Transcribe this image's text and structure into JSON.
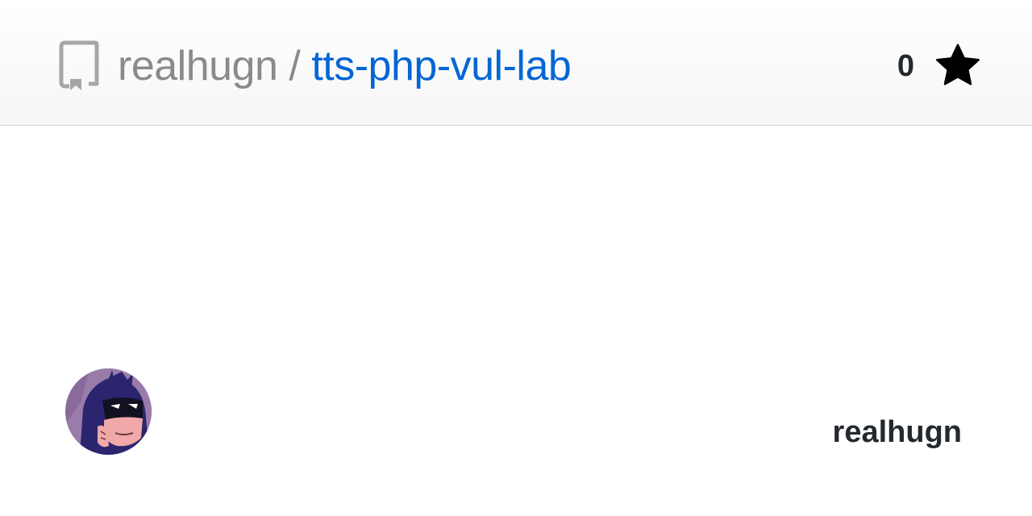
{
  "header": {
    "owner": "realhugn",
    "separator": "/",
    "repo_name": "tts-php-vul-lab",
    "star_count": "0",
    "icons": {
      "repo": "repo-book-icon",
      "star": "star-icon"
    }
  },
  "footer": {
    "author_name": "realhugn",
    "avatar": "avatar-icon"
  },
  "colors": {
    "owner_text": "#8a8a8a",
    "repo_link": "#0366d6",
    "dark_text": "#24292e"
  }
}
